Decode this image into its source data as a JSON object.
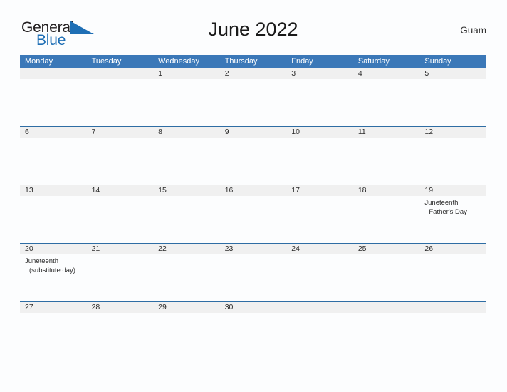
{
  "logo": {
    "word_top": "General",
    "word_bottom": "Blue",
    "flag_icon": "blue-triangle-flag-icon",
    "flag_color": "#1f6fb5"
  },
  "header": {
    "title": "June 2022",
    "region": "Guam"
  },
  "theme": {
    "header_blue": "#3b78b8",
    "rule_blue": "#2e6da4",
    "date_band_gray": "#f0f0f0",
    "page_background": "#fcfdfe",
    "logo_blue": "#1f6fb5"
  },
  "calendar": {
    "weekday_headers": [
      "Monday",
      "Tuesday",
      "Wednesday",
      "Thursday",
      "Friday",
      "Saturday",
      "Sunday"
    ],
    "weeks": [
      {
        "days": [
          {
            "date": "",
            "events": []
          },
          {
            "date": "",
            "events": []
          },
          {
            "date": "1",
            "events": []
          },
          {
            "date": "2",
            "events": []
          },
          {
            "date": "3",
            "events": []
          },
          {
            "date": "4",
            "events": []
          },
          {
            "date": "5",
            "events": []
          }
        ]
      },
      {
        "days": [
          {
            "date": "6",
            "events": []
          },
          {
            "date": "7",
            "events": []
          },
          {
            "date": "8",
            "events": []
          },
          {
            "date": "9",
            "events": []
          },
          {
            "date": "10",
            "events": []
          },
          {
            "date": "11",
            "events": []
          },
          {
            "date": "12",
            "events": []
          }
        ]
      },
      {
        "days": [
          {
            "date": "13",
            "events": []
          },
          {
            "date": "14",
            "events": []
          },
          {
            "date": "15",
            "events": []
          },
          {
            "date": "16",
            "events": []
          },
          {
            "date": "17",
            "events": []
          },
          {
            "date": "18",
            "events": []
          },
          {
            "date": "19",
            "events": [
              "Juneteenth",
              "Father's Day"
            ]
          }
        ]
      },
      {
        "days": [
          {
            "date": "20",
            "events": [
              "Juneteenth",
              "(substitute day)"
            ]
          },
          {
            "date": "21",
            "events": []
          },
          {
            "date": "22",
            "events": []
          },
          {
            "date": "23",
            "events": []
          },
          {
            "date": "24",
            "events": []
          },
          {
            "date": "25",
            "events": []
          },
          {
            "date": "26",
            "events": []
          }
        ]
      },
      {
        "days": [
          {
            "date": "27",
            "events": []
          },
          {
            "date": "28",
            "events": []
          },
          {
            "date": "29",
            "events": []
          },
          {
            "date": "30",
            "events": []
          },
          {
            "date": "",
            "events": []
          },
          {
            "date": "",
            "events": []
          },
          {
            "date": "",
            "events": []
          }
        ]
      }
    ]
  }
}
